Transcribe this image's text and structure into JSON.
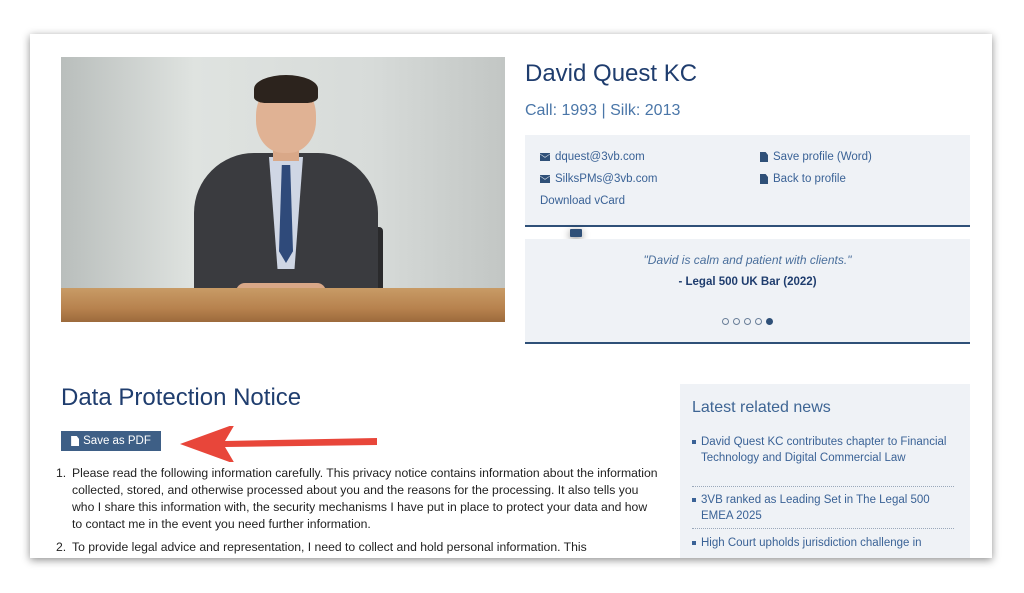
{
  "profile": {
    "name": "David Quest KC",
    "call_silk": "Call: 1993 | Silk: 2013"
  },
  "contacts": {
    "email": "dquest@3vb.com",
    "pm_email": "SilksPMs@3vb.com",
    "vcard": "Download vCard",
    "save_word": "Save profile (Word)",
    "back": "Back to profile"
  },
  "testimonial": {
    "quote": "\"David is calm and patient with clients.\"",
    "source": "- Legal 500 UK Bar (2022)",
    "slides": 5,
    "active_slide": 5
  },
  "notice": {
    "title": "Data Protection Notice",
    "pdf_button": "Save as PDF",
    "items": [
      {
        "num": "1.",
        "text": "Please read the following information carefully. This privacy notice contains information about the information collected, stored, and otherwise processed about you and the reasons for the processing. It also tells you who I share this information with, the security mechanisms I have put in place to protect your data and how to contact me in the event you need further information."
      },
      {
        "num": "2.",
        "text": "To provide legal advice and representation, I need to collect and hold personal information. This"
      }
    ]
  },
  "news": {
    "title": "Latest related news",
    "items": [
      "David Quest KC contributes chapter to Financial Technology and Digital Commercial Law",
      "3VB ranked as Leading Set in The Legal 500 EMEA 2025",
      "High Court upholds jurisdiction challenge in"
    ]
  },
  "colors": {
    "accent": "#1f3d6e",
    "link": "#3a6296",
    "panel_bg": "#eff2f6",
    "button_bg": "#3e5f86",
    "arrow": "#e8463a"
  }
}
